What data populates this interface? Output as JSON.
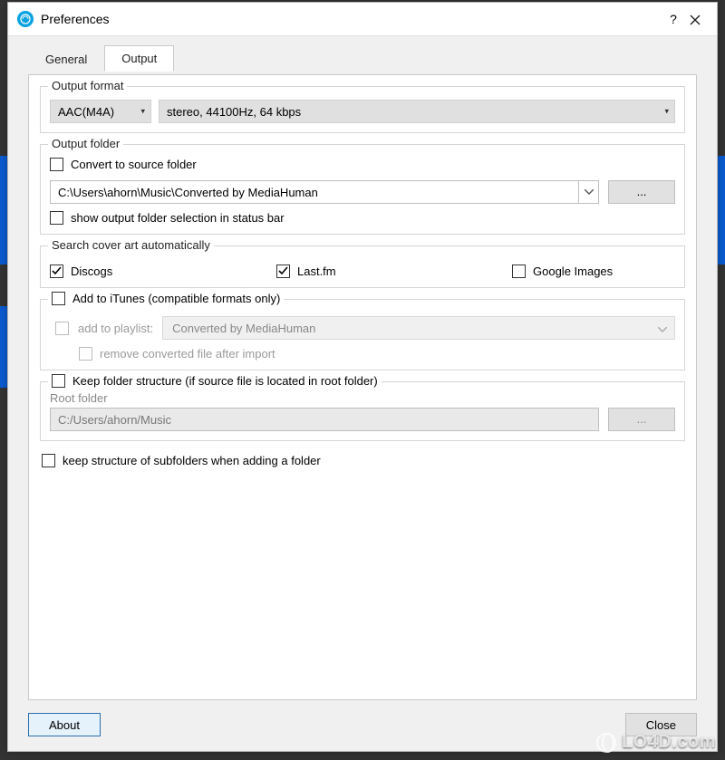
{
  "window": {
    "title": "Preferences"
  },
  "tabs": {
    "general": "General",
    "output": "Output"
  },
  "outputFormat": {
    "legend": "Output format",
    "format": "AAC(M4A)",
    "quality": "stereo, 44100Hz, 64 kbps"
  },
  "outputFolder": {
    "legend": "Output folder",
    "convertToSource": "Convert to source folder",
    "path": "C:\\Users\\ahorn\\Music\\Converted by MediaHuman",
    "browse": "...",
    "showInStatusBar": "show output folder selection in status bar"
  },
  "coverArt": {
    "legend": "Search cover art automatically",
    "discogs": "Discogs",
    "lastfm": "Last.fm",
    "google": "Google Images"
  },
  "itunes": {
    "head": "Add to iTunes (compatible formats only)",
    "addToPlaylist": "add to playlist:",
    "playlist": "Converted by MediaHuman",
    "removeAfter": "remove converted file after import"
  },
  "keepStructure": {
    "head": "Keep folder structure (if source file is located in root folder)",
    "rootLabel": "Root folder",
    "rootPath": "C:/Users/ahorn/Music",
    "browse": "..."
  },
  "keepSubfolders": "keep structure of subfolders when adding a folder",
  "buttons": {
    "about": "About",
    "close": "Close"
  },
  "watermark": "LO4D.com"
}
